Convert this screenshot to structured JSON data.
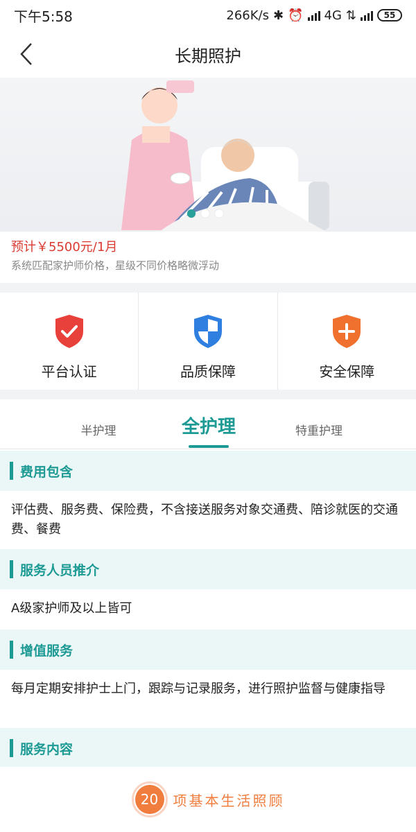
{
  "status_bar": {
    "time": "下午5:58",
    "speed": "266K/s",
    "network": "4G",
    "battery": "55"
  },
  "header": {
    "title": "长期照护"
  },
  "banner": {
    "slides": 3,
    "active_index": 0
  },
  "pricing": {
    "price": "预计￥5500元/1月",
    "note": "系统匹配家护师价格，星级不同价格略微浮动"
  },
  "guarantees": [
    {
      "label": "平台认证",
      "icon": "shield-check-icon",
      "color": "#e8403a"
    },
    {
      "label": "品质保障",
      "icon": "shield-quality-icon",
      "color": "#2f7fe0"
    },
    {
      "label": "安全保障",
      "icon": "shield-plus-icon",
      "color": "#f0702e"
    }
  ],
  "tabs": [
    {
      "label": "半护理"
    },
    {
      "label": "全护理"
    },
    {
      "label": "特重护理"
    }
  ],
  "sections": [
    {
      "title": "费用包含",
      "body": "评估费、服务费、保险费，不含接送服务对象交通费、陪诊就医的交通费、餐费"
    },
    {
      "title": "服务人员推介",
      "body": "A级家护师及以上皆可"
    },
    {
      "title": "增值服务",
      "body": "每月定期安排护士上门，跟踪与记录服务，进行照护监督与健康指导"
    },
    {
      "title": "服务内容",
      "body": ""
    }
  ],
  "footer": {
    "count": "20",
    "text": "项基本生活照顾"
  },
  "colors": {
    "accent": "#1e9a95",
    "price": "#d93a2f",
    "footer": "#f07d3e"
  }
}
